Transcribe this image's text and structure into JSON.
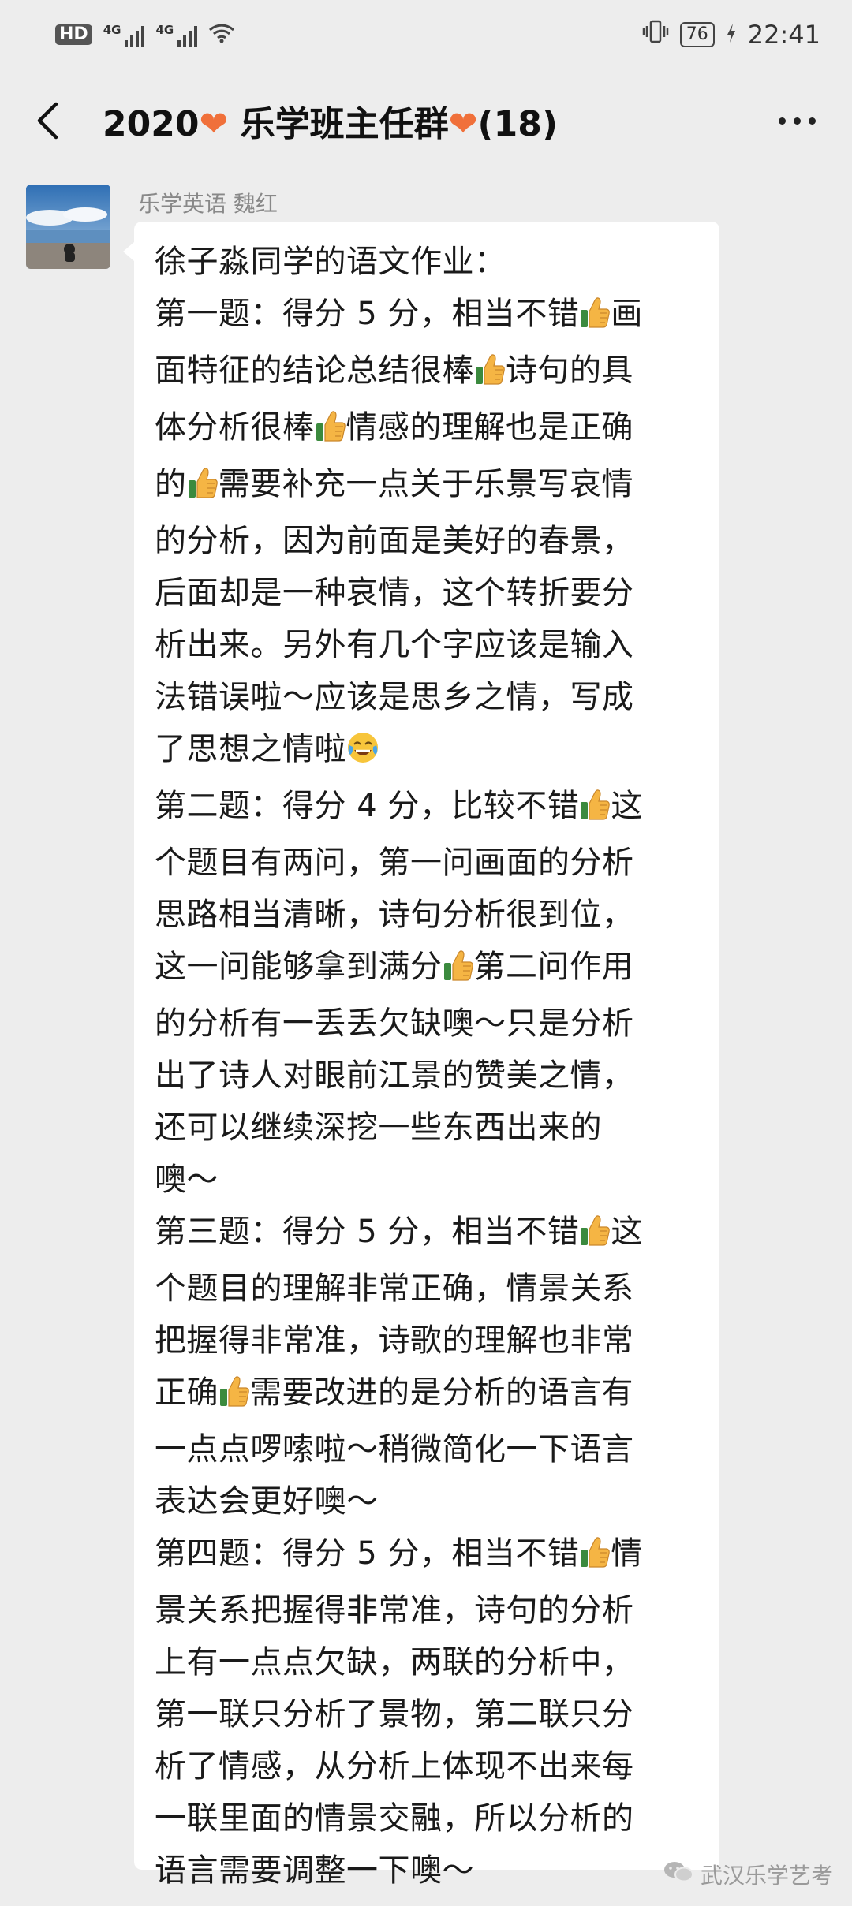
{
  "status_bar": {
    "hd_label": "HD",
    "sim1_label": "4G",
    "sim2_label": "4G",
    "battery": "76",
    "time": "22:41"
  },
  "header": {
    "title_prefix": "2020",
    "title_middle": " 乐学班主任群",
    "title_suffix": "(18)",
    "heart_icon": "❤"
  },
  "message": {
    "sender": "乐学英语 魏红",
    "lines": [
      [
        {
          "t": "徐子淼同学的语文作业："
        }
      ],
      [
        {
          "t": "第一题：得分 5 分，相当不错"
        },
        {
          "e": "thumbs-up-icon"
        },
        {
          "t": "画"
        }
      ],
      [
        {
          "t": "面特征的结论总结很棒"
        },
        {
          "e": "thumbs-up-icon"
        },
        {
          "t": "诗句的具"
        }
      ],
      [
        {
          "t": "体分析很棒"
        },
        {
          "e": "thumbs-up-icon"
        },
        {
          "t": "情感的理解也是正确"
        }
      ],
      [
        {
          "t": "的"
        },
        {
          "e": "thumbs-up-icon"
        },
        {
          "t": "需要补充一点关于乐景写哀情"
        }
      ],
      [
        {
          "t": "的分析，因为前面是美好的春景，"
        }
      ],
      [
        {
          "t": "后面却是一种哀情，这个转折要分"
        }
      ],
      [
        {
          "t": "析出来。另外有几个字应该是输入"
        }
      ],
      [
        {
          "t": "法错误啦～应该是思乡之情，写成"
        }
      ],
      [
        {
          "t": "了思想之情啦"
        },
        {
          "e": "tears-of-joy-icon"
        }
      ],
      [
        {
          "t": "第二题：得分 4 分，比较不错"
        },
        {
          "e": "thumbs-up-icon"
        },
        {
          "t": "这"
        }
      ],
      [
        {
          "t": "个题目有两问，第一问画面的分析"
        }
      ],
      [
        {
          "t": "思路相当清晰，诗句分析很到位，"
        }
      ],
      [
        {
          "t": "这一问能够拿到满分"
        },
        {
          "e": "thumbs-up-icon"
        },
        {
          "t": "第二问作用"
        }
      ],
      [
        {
          "t": "的分析有一丢丢欠缺噢～只是分析"
        }
      ],
      [
        {
          "t": "出了诗人对眼前江景的赞美之情，"
        }
      ],
      [
        {
          "t": "还可以继续深挖一些东西出来的"
        }
      ],
      [
        {
          "t": "噢～"
        }
      ],
      [
        {
          "t": "第三题：得分 5 分，相当不错"
        },
        {
          "e": "thumbs-up-icon"
        },
        {
          "t": "这"
        }
      ],
      [
        {
          "t": "个题目的理解非常正确，情景关系"
        }
      ],
      [
        {
          "t": "把握得非常准，诗歌的理解也非常"
        }
      ],
      [
        {
          "t": "正确"
        },
        {
          "e": "thumbs-up-icon"
        },
        {
          "t": "需要改进的是分析的语言有"
        }
      ],
      [
        {
          "t": "一点点啰嗦啦～稍微简化一下语言"
        }
      ],
      [
        {
          "t": "表达会更好噢～"
        }
      ],
      [
        {
          "t": "第四题：得分 5 分，相当不错"
        },
        {
          "e": "thumbs-up-icon"
        },
        {
          "t": "情"
        }
      ],
      [
        {
          "t": "景关系把握得非常准，诗句的分析"
        }
      ],
      [
        {
          "t": "上有一点点欠缺，两联的分析中，"
        }
      ],
      [
        {
          "t": "第一联只分析了景物，第二联只分"
        }
      ],
      [
        {
          "t": "析了情感，从分析上体现不出来每"
        }
      ],
      [
        {
          "t": "一联里面的情景交融，所以分析的"
        }
      ],
      [
        {
          "t": "语言需要调整一下噢～"
        }
      ]
    ]
  },
  "watermark": {
    "text": "武汉乐学艺考",
    "icon": "wechat-icon"
  }
}
